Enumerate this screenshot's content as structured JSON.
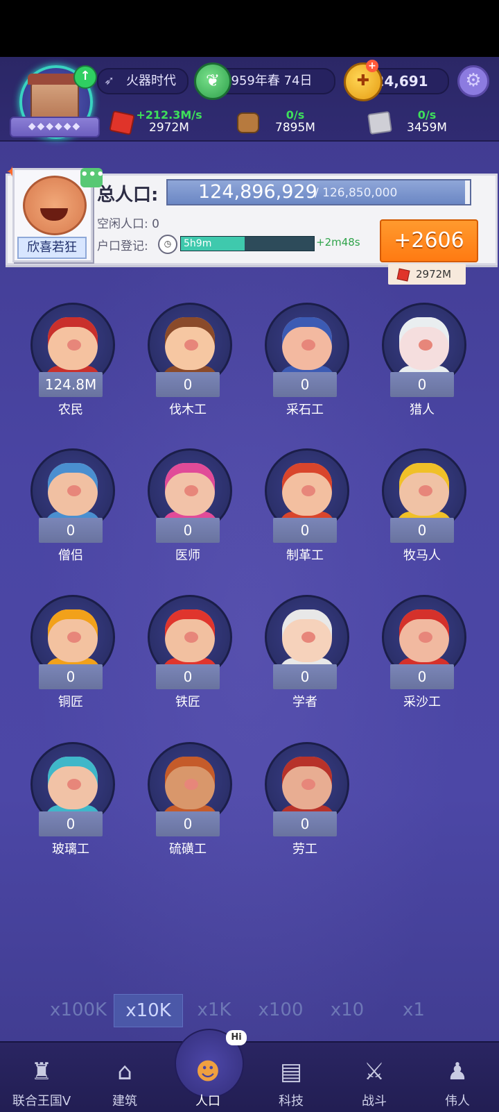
{
  "header": {
    "era_label": "火器时代",
    "date_label": "959年春 74日",
    "coins": "24,691",
    "resources": [
      {
        "icon": "red-ore-icon",
        "rate": "+212.3M/s",
        "amount": "2972M"
      },
      {
        "icon": "wood-icon",
        "rate": "0/s",
        "amount": "7895M"
      },
      {
        "icon": "stone-icon",
        "rate": "0/s",
        "amount": "3459M"
      }
    ],
    "colors": {
      "accent_green": "#3ee05a",
      "panel_bg": "#4a45a3"
    }
  },
  "population": {
    "mood_label": "欣喜若狂",
    "title": "总人口:",
    "current": "124,896,929",
    "max": "/ 126,850,000",
    "fill_fraction": 0.985,
    "idle_text": "空闲人口: 0",
    "register_label": "户口登记:",
    "register_time": "5h9m",
    "register_fill_fraction": 0.48,
    "register_bonus": "+2m48s",
    "add_button": "+2606",
    "add_cost": "2972M"
  },
  "jobs": [
    {
      "name": "农民",
      "count": "124.8M"
    },
    {
      "name": "伐木工",
      "count": "0"
    },
    {
      "name": "采石工",
      "count": "0"
    },
    {
      "name": "猎人",
      "count": "0"
    },
    {
      "name": "僧侣",
      "count": "0"
    },
    {
      "name": "医师",
      "count": "0"
    },
    {
      "name": "制革工",
      "count": "0"
    },
    {
      "name": "牧马人",
      "count": "0"
    },
    {
      "name": "铜匠",
      "count": "0"
    },
    {
      "name": "铁匠",
      "count": "0"
    },
    {
      "name": "学者",
      "count": "0"
    },
    {
      "name": "采沙工",
      "count": "0"
    },
    {
      "name": "玻璃工",
      "count": "0"
    },
    {
      "name": "硫磺工",
      "count": "0"
    },
    {
      "name": "劳工",
      "count": "0"
    }
  ],
  "multipliers": {
    "options": [
      "x100K",
      "x10K",
      "x1K",
      "x100",
      "x10",
      "x1"
    ],
    "selected": "x10K"
  },
  "nav": {
    "items": [
      "联合王国V",
      "建筑",
      "人口",
      "科技",
      "战斗",
      "伟人"
    ],
    "active": "人口",
    "hi_badge": "Hi"
  }
}
